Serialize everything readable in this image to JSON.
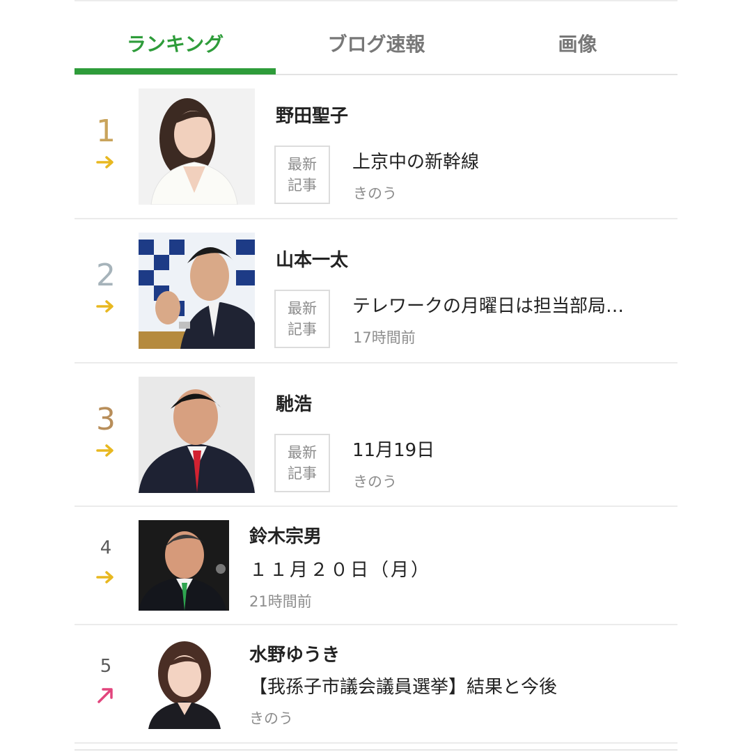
{
  "tabs": [
    {
      "label": "ランキング",
      "active": true
    },
    {
      "label": "ブログ速報",
      "active": false
    },
    {
      "label": "画像",
      "active": false
    }
  ],
  "colors": {
    "accent": "#2e9c3a",
    "rank_gold": "#c9a45c",
    "rank_silver": "#a6b3ba",
    "rank_bronze": "#b88e5a",
    "arrow_flat": "#e8b820",
    "arrow_up": "#e2457d"
  },
  "ranking": [
    {
      "rank": "1",
      "trend": "flat-arrow-icon",
      "name": "野田聖子",
      "badge": [
        "最新",
        "記事"
      ],
      "title": "上京中の新幹線",
      "time": "きのう"
    },
    {
      "rank": "2",
      "trend": "flat-arrow-icon",
      "name": "山本一太",
      "badge": [
        "最新",
        "記事"
      ],
      "title": "テレワークの月曜日は担当部局…",
      "time": "17時間前"
    },
    {
      "rank": "3",
      "trend": "flat-arrow-icon",
      "name": "馳浩",
      "badge": [
        "最新",
        "記事"
      ],
      "title": "11月19日",
      "time": "きのう"
    },
    {
      "rank": "4",
      "trend": "flat-arrow-icon",
      "name": "鈴木宗男",
      "title": "１１月２０日（月）",
      "time": "21時間前"
    },
    {
      "rank": "5",
      "trend": "up-arrow-icon",
      "name": "水野ゆうき",
      "title": "【我孫子市議会議員選挙】結果と今後",
      "time": "きのう"
    }
  ]
}
